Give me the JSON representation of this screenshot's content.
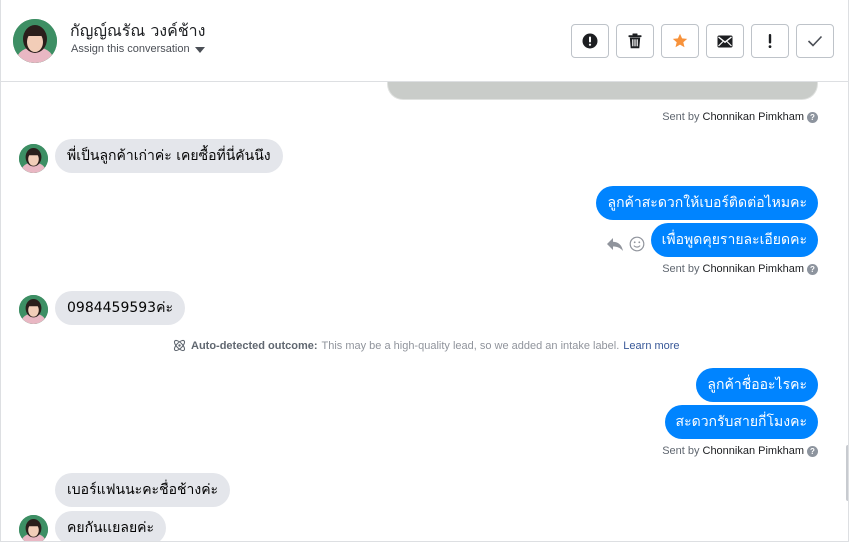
{
  "header": {
    "contact_name": "กัญญ์ณรัณ วงค์ช้าง",
    "assign_label": "Assign this conversation",
    "actions": [
      {
        "name": "report-spam-button",
        "icon": "alert-circle-icon"
      },
      {
        "name": "delete-button",
        "icon": "trash-icon"
      },
      {
        "name": "star-button",
        "icon": "star-icon"
      },
      {
        "name": "mark-unread-button",
        "icon": "envelope-icon"
      },
      {
        "name": "follow-up-button",
        "icon": "exclamation-icon"
      },
      {
        "name": "mark-done-button",
        "icon": "check-icon"
      }
    ]
  },
  "thread": {
    "sent_by_prefix": "Sent by",
    "sender_name": "Chonnikan Pimkham",
    "messages": {
      "in_1": "พี่เป็นลูกค้าเก่าค่ะ เคยซื้อที่นี่คันนึง",
      "out_1": "ลูกค้าสะดวกให้เบอร์ติดต่อไหมคะ",
      "out_2": "เพื่อพูดคุยรายละเอียดคะ",
      "in_2": "0984459593ค่ะ",
      "out_3": "ลูกค้าชื่ออะไรคะ",
      "out_4": "สะดวกรับสายกี่โมงคะ",
      "in_3": "เบอร์แฟนนะคะชื่อช้างค่ะ",
      "in_4": "คยกันเเยลยค่ะ"
    },
    "auto_detect": {
      "label": "Auto-detected outcome:",
      "text": "This may be a high-quality lead, so we added an intake label.",
      "link": "Learn more"
    }
  },
  "colors": {
    "outgoing_bubble": "#0084ff",
    "incoming_bubble": "#e4e6eb",
    "star": "#f7923b",
    "link": "#385898"
  }
}
